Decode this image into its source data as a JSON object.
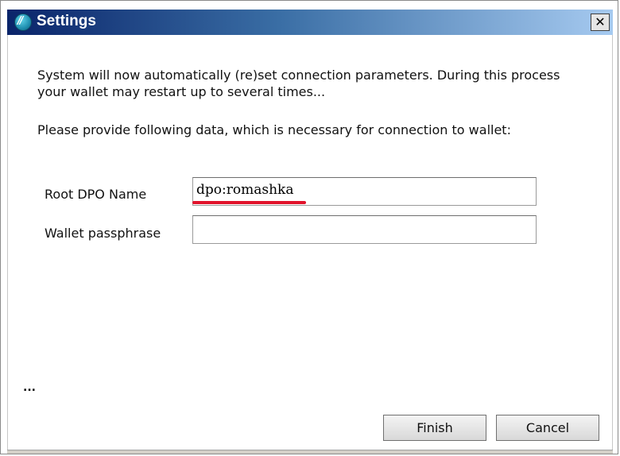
{
  "window": {
    "title": "Settings",
    "close_glyph": "✕",
    "title_gradient_start": "#0a246a",
    "title_gradient_end": "#a6caf0"
  },
  "message": {
    "intro": "System will now automatically (re)set connection parameters. During this process your wallet may restart up to several times...",
    "prompt": "Please provide following data, which is necessary for connection to wallet:"
  },
  "form": {
    "root_dpo_label": "Root DPO Name",
    "root_dpo_value": "dpo:romashka",
    "passphrase_label": "Wallet passphrase",
    "passphrase_value": ""
  },
  "status": {
    "ellipsis": "..."
  },
  "buttons": {
    "finish": "Finish",
    "cancel": "Cancel"
  },
  "annotation": {
    "underline_color": "#e0132b"
  }
}
